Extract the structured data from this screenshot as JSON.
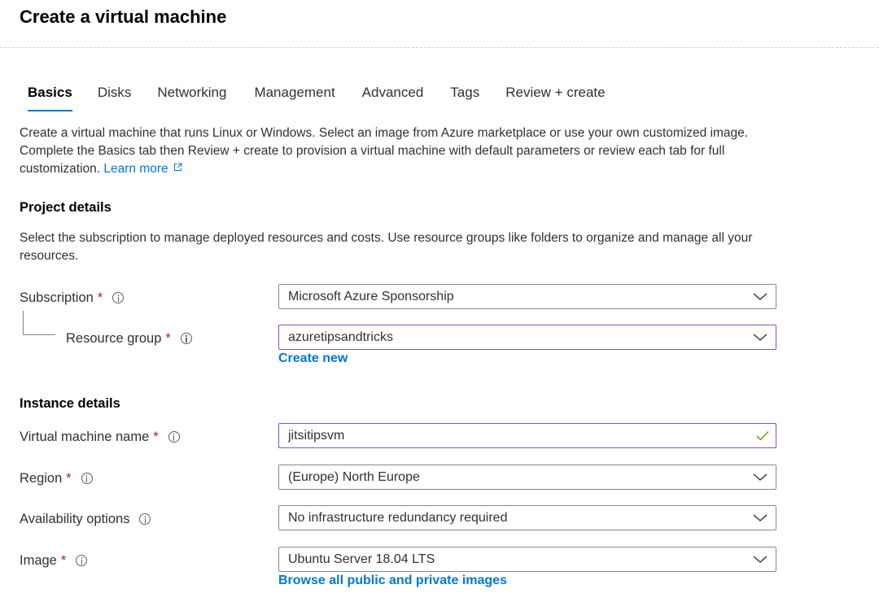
{
  "page": {
    "title": "Create a virtual machine"
  },
  "tabs": [
    {
      "label": "Basics",
      "active": true
    },
    {
      "label": "Disks"
    },
    {
      "label": "Networking"
    },
    {
      "label": "Management"
    },
    {
      "label": "Advanced"
    },
    {
      "label": "Tags"
    },
    {
      "label": "Review + create"
    }
  ],
  "intro": {
    "text": "Create a virtual machine that runs Linux or Windows. Select an image from Azure marketplace or use your own customized image. Complete the Basics tab then Review + create to provision a virtual machine with default parameters or review each tab for full customization.",
    "learn_more": "Learn more"
  },
  "project": {
    "heading": "Project details",
    "description": "Select the subscription to manage deployed resources and costs. Use resource groups like folders to organize and manage all your resources.",
    "subscription": {
      "label": "Subscription",
      "value": "Microsoft Azure Sponsorship"
    },
    "resource_group": {
      "label": "Resource group",
      "value": "azuretipsandtricks",
      "create_new": "Create new"
    }
  },
  "instance": {
    "heading": "Instance details",
    "vm_name": {
      "label": "Virtual machine name",
      "value": "jitsitipsvm"
    },
    "region": {
      "label": "Region",
      "value": "(Europe) North Europe"
    },
    "availability": {
      "label": "Availability options",
      "value": "No infrastructure redundancy required"
    },
    "image": {
      "label": "Image",
      "value": "Ubuntu Server 18.04 LTS",
      "browse": "Browse all public and private images"
    }
  },
  "common": {
    "required_marker": "*"
  },
  "colors": {
    "accent": "#0078d4",
    "required": "#a4262c",
    "focus_border": "#8a4ec6",
    "valid_check": "#57a300"
  },
  "icons": [
    "info-icon",
    "chevron-down-icon",
    "checkmark-icon",
    "external-link-icon"
  ]
}
